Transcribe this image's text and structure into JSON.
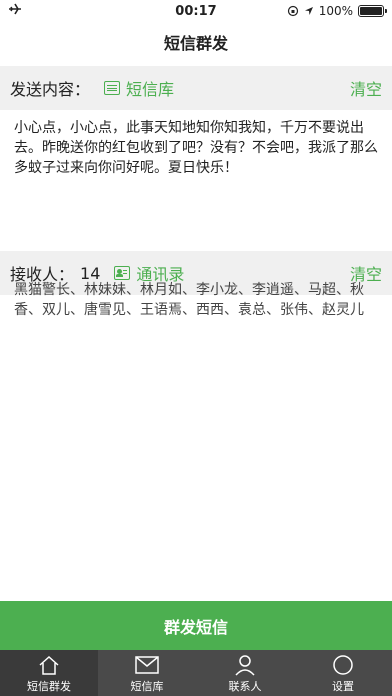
{
  "status_bar": {
    "time": "00:17",
    "battery_text": "100%",
    "battery_level": 1.0
  },
  "nav": {
    "title": "短信群发"
  },
  "content_section": {
    "label": "发送内容：",
    "library_link": "短信库",
    "clear": "清空",
    "message": "小心点，小心点，此事天知地知你知我知，千万不要说出去。昨晚送你的红包收到了吧？没有？不会吧，我派了那么多蚊子过来向你问好呢。夏日快乐！"
  },
  "recipient_section": {
    "label": "接收人：",
    "count": "14",
    "contacts_link": "通讯录",
    "clear": "清空",
    "names": "黑猫警长、林妹妹、林月如、李小龙、李逍遥、马超、秋香、双儿、唐雪见、王语焉、西西、袁总、张伟、赵灵儿"
  },
  "send_button": {
    "label": "群发短信"
  },
  "tabs": [
    {
      "label": "短信群发",
      "icon": "home-icon",
      "active": true
    },
    {
      "label": "短信库",
      "icon": "mail-icon",
      "active": false
    },
    {
      "label": "联系人",
      "icon": "person-icon",
      "active": false
    },
    {
      "label": "设置",
      "icon": "gear-icon",
      "active": false
    }
  ],
  "colors": {
    "accent": "#4caf50",
    "tab_bar": "#4a4a4a",
    "section_bg": "#f0f0f0"
  }
}
